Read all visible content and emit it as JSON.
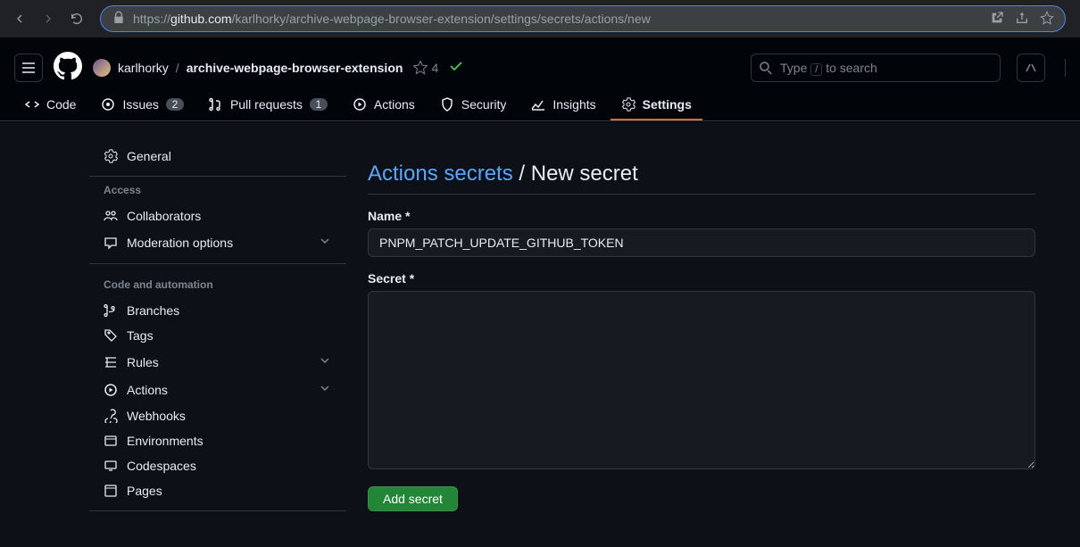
{
  "url": {
    "scheme": "https://",
    "host": "github.com",
    "path": "/karlhorky/archive-webpage-browser-extension/settings/secrets/actions/new"
  },
  "breadcrumb": {
    "owner": "karlhorky",
    "separator": "/",
    "repo": "archive-webpage-browser-extension",
    "stars": "4"
  },
  "search": {
    "prefix": "Type ",
    "key": "/",
    "suffix": " to search"
  },
  "tabs": [
    {
      "icon": "code",
      "label": "Code"
    },
    {
      "icon": "issue",
      "label": "Issues",
      "count": "2"
    },
    {
      "icon": "pr",
      "label": "Pull requests",
      "count": "1"
    },
    {
      "icon": "play",
      "label": "Actions"
    },
    {
      "icon": "shield",
      "label": "Security"
    },
    {
      "icon": "graph",
      "label": "Insights"
    },
    {
      "icon": "gear",
      "label": "Settings",
      "active": true
    }
  ],
  "sidebar": {
    "general": "General",
    "groups": [
      {
        "title": "Access",
        "items": [
          {
            "icon": "people",
            "label": "Collaborators"
          },
          {
            "icon": "comment",
            "label": "Moderation options",
            "chevron": true
          }
        ]
      },
      {
        "title": "Code and automation",
        "items": [
          {
            "icon": "branch",
            "label": "Branches"
          },
          {
            "icon": "tag",
            "label": "Tags"
          },
          {
            "icon": "rules",
            "label": "Rules",
            "chevron": true
          },
          {
            "icon": "play",
            "label": "Actions",
            "chevron": true
          },
          {
            "icon": "webhook",
            "label": "Webhooks"
          },
          {
            "icon": "env",
            "label": "Environments"
          },
          {
            "icon": "codespaces",
            "label": "Codespaces"
          },
          {
            "icon": "pages",
            "label": "Pages"
          }
        ]
      }
    ]
  },
  "page": {
    "title_link": "Actions secrets",
    "title_sep": " / ",
    "title_current": "New secret"
  },
  "form": {
    "name_label": "Name *",
    "name_value": "PNPM_PATCH_UPDATE_GITHUB_TOKEN",
    "secret_label": "Secret *",
    "secret_value": "",
    "submit_label": "Add secret"
  }
}
